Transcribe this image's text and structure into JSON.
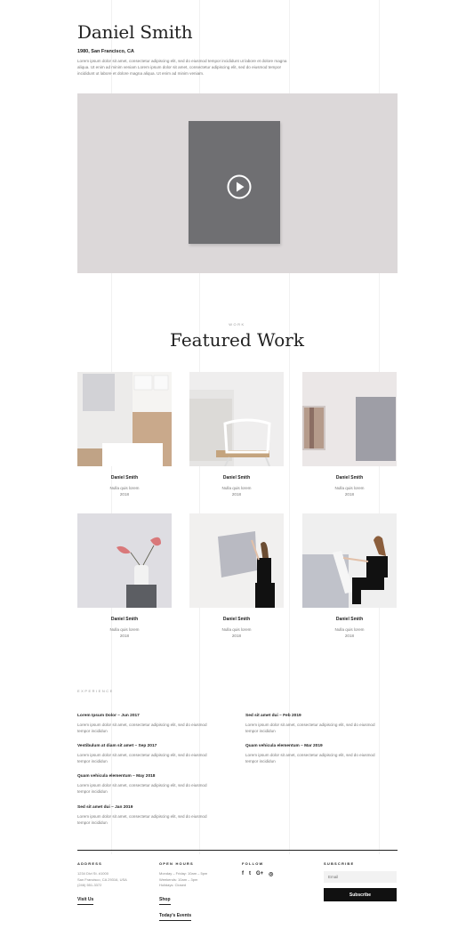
{
  "header": {
    "name": "Daniel Smith",
    "location": "1980, San Francisco, CA",
    "intro": "Lorem ipsum dolor sit amet, consectetur adipiscing elit, sed do eiusmod tempor incididunt ut labore et dolore magna aliqua. Ut enim ad minim veniam Lorem ipsum dolor sit amet, consectetur adipiscing elit, sed do eiusmod tempor incididunt ut labore et dolore magna aliqua. Ut enim ad minim veniam."
  },
  "video": {
    "play_icon": "play-icon"
  },
  "featured": {
    "kicker": "WORK",
    "title": "Featured Work",
    "items": [
      {
        "name": "Daniel Smith",
        "subtitle": "Nulla quis lorem",
        "year": "2018"
      },
      {
        "name": "Daniel Smith",
        "subtitle": "Nulla quis lorem",
        "year": "2018"
      },
      {
        "name": "Daniel Smith",
        "subtitle": "Nulla quis lorem",
        "year": "2018"
      },
      {
        "name": "Daniel Smith",
        "subtitle": "Nulla quis lorem",
        "year": "2018"
      },
      {
        "name": "Daniel Smith",
        "subtitle": "Nulla quis lorem",
        "year": "2018"
      },
      {
        "name": "Daniel Smith",
        "subtitle": "Nulla quis lorem",
        "year": "2018"
      }
    ]
  },
  "experience": {
    "kicker": "EXPERIENCE",
    "left": [
      {
        "title": "Lorem Ipsum Dolor – Jun 2017",
        "body": "Lorem ipsum dolor sit amet, consectetur adipiscing elit, sed do eiusmod tempor incididun"
      },
      {
        "title": "Vestibulum at diam sit amet – Sep 2017",
        "body": "Lorem ipsum dolor sit amet, consectetur adipiscing elit, sed do eiusmod tempor incididun"
      },
      {
        "title": "Quam vehicula elementum – May 2018",
        "body": "Lorem ipsum dolor sit amet, consectetur adipiscing elit, sed do eiusmod tempor incididun"
      },
      {
        "title": "Sed sit amet dui – Jan 2019",
        "body": "Lorem ipsum dolor sit amet, consectetur adipiscing elit, sed do eiusmod tempor incididun"
      }
    ],
    "right": [
      {
        "title": "Sed sit amet dui – Feb 2019",
        "body": "Lorem ipsum dolor sit amet, consectetur adipiscing elit, sed do eiusmod tempor incididun"
      },
      {
        "title": "Quam vehicula elementum – Mar 2019",
        "body": "Lorem ipsum dolor sit amet, consectetur adipiscing elit, sed do eiusmod tempor incididun"
      }
    ]
  },
  "footer": {
    "address": {
      "heading": "ADDRESS",
      "line1": "1234 Divi St. #1000",
      "line2": "San Francisco, CA 29316, USA",
      "line3": "(246) 551-3372",
      "link": "Visit Us"
    },
    "hours": {
      "heading": "OPEN HOURS",
      "line1": "Monday – Friday: 10am – 5pm",
      "line2": "Weekends: 10am – 3pm",
      "line3": "Holidays: Closed",
      "link1": "Shop",
      "link2": "Today's Events"
    },
    "follow": {
      "heading": "FOLLOW",
      "icons": [
        "facebook-icon",
        "twitter-icon",
        "google-plus-icon",
        "instagram-icon"
      ],
      "glyphs": [
        "f",
        "t",
        "G+",
        "◎"
      ]
    },
    "subscribe": {
      "heading": "SUBSCRIBE",
      "placeholder": "Email",
      "button": "Subscribe"
    }
  }
}
